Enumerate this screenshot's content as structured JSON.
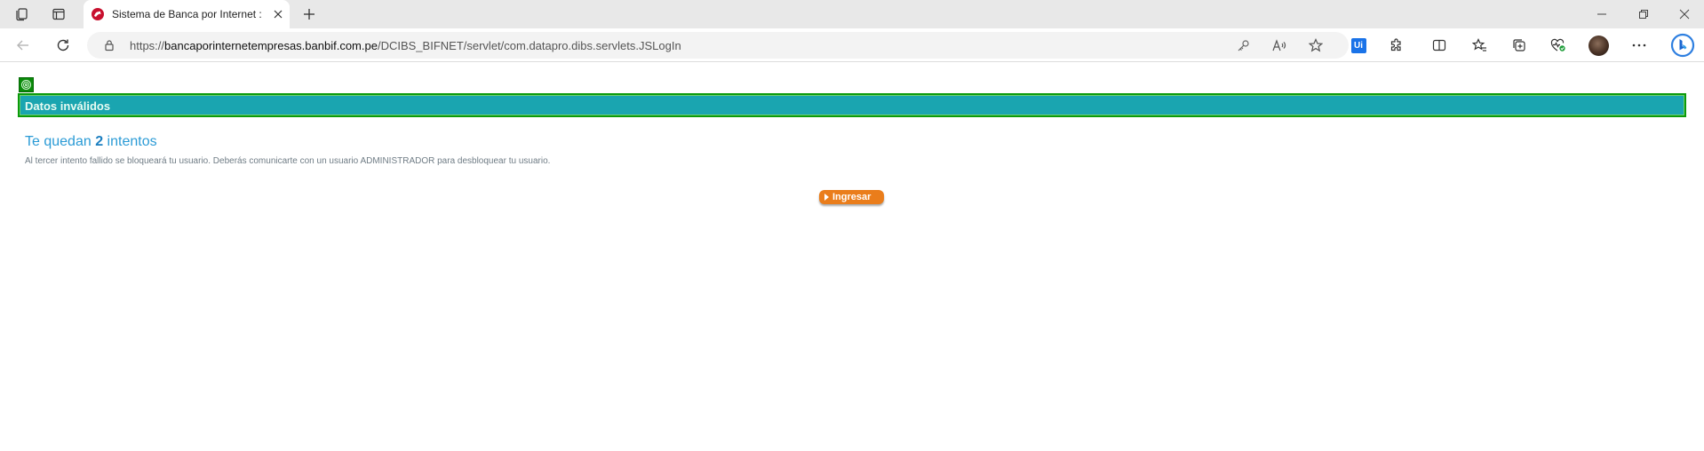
{
  "browser": {
    "tab": {
      "title": "Sistema de Banca por Internet : D",
      "favicon": "banbif-favicon"
    },
    "address": {
      "scheme": "https://",
      "host": "bancaporinternetempresas.banbif.com.pe",
      "path": "/DCIBS_BIFNET/servlet/com.datapro.dibs.servlets.JSLogIn"
    },
    "toolbar_icons": [
      "back-icon",
      "refresh-icon",
      "lock-icon",
      "key-icon",
      "read-aloud-icon",
      "favorite-star-icon",
      "ui-extension-icon",
      "extensions-icon",
      "split-screen-icon",
      "favorites-icon",
      "collections-icon",
      "browser-essentials-icon",
      "profile-avatar",
      "more-icon",
      "bing-icon"
    ],
    "ui_badge": "Ui"
  },
  "page": {
    "banner_title": "Datos inválidos",
    "attempts_prefix": "Te quedan",
    "attempts_count": "2",
    "attempts_suffix": "intentos",
    "warning": "Al tercer intento fallido se bloqueará tu usuario. Deberás comunicarte con un usuario ADMINISTRADOR para desbloquear tu usuario.",
    "button_label": "Ingresar"
  },
  "colors": {
    "banner_bg": "#1aa5b0",
    "banner_border": "#0b9a0b",
    "attempts_text": "#2b9bd6",
    "button_bg": "#ea7d1b"
  }
}
